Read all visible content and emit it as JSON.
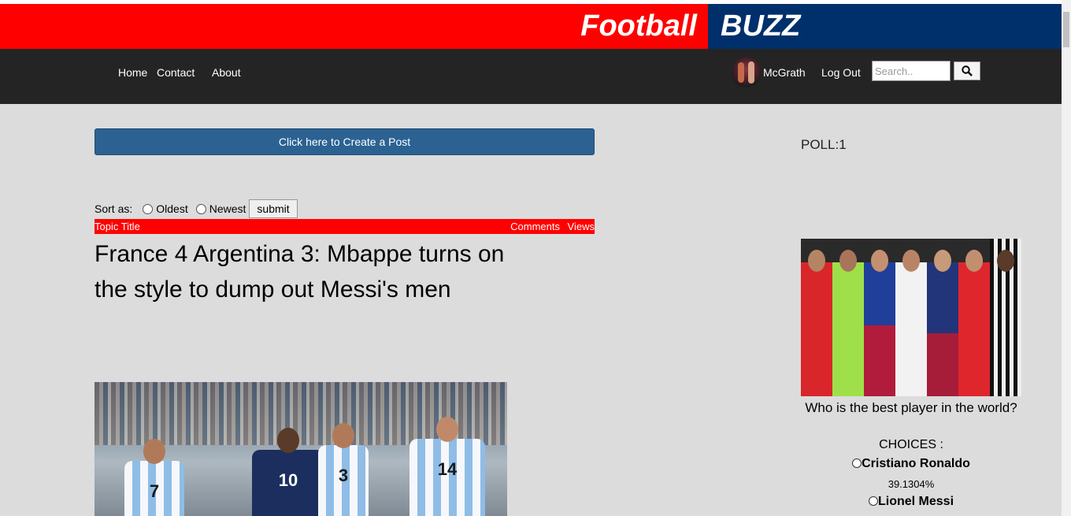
{
  "banner": {
    "left_text": "Football",
    "right_text": "BUZZ"
  },
  "nav": {
    "home": "Home",
    "contact": "Contact",
    "about": "About",
    "username": "McGrath",
    "logout": "Log Out",
    "search_placeholder": "Search.."
  },
  "main": {
    "create_post_label": "Click here to Create a Post",
    "sort": {
      "label": "Sort as:",
      "options": [
        "Oldest",
        "Newest"
      ],
      "submit_label": "submit"
    },
    "table_header": {
      "topic": "Topic Title",
      "comments": "Comments",
      "views": "Views"
    },
    "post": {
      "title": "France 4 Argentina 3: Mbappe turns on the style to dump out Messi's men",
      "shirt_numbers": [
        "7",
        "10",
        "3",
        "14"
      ]
    }
  },
  "poll": {
    "label": "POLL:1",
    "question": "Who is the best player in the world?",
    "choices_label": "CHOICES :",
    "choices": [
      {
        "name": "Cristiano Ronaldo",
        "percent": "39.1304%"
      },
      {
        "name": "Lionel Messi"
      }
    ]
  },
  "colors": {
    "banner_red": "#ff0000",
    "banner_blue": "#00306b",
    "nav_bg": "#242424",
    "page_bg": "#dcdcdc",
    "button_blue": "#2b6292"
  },
  "icons": {
    "search": "search-icon"
  }
}
